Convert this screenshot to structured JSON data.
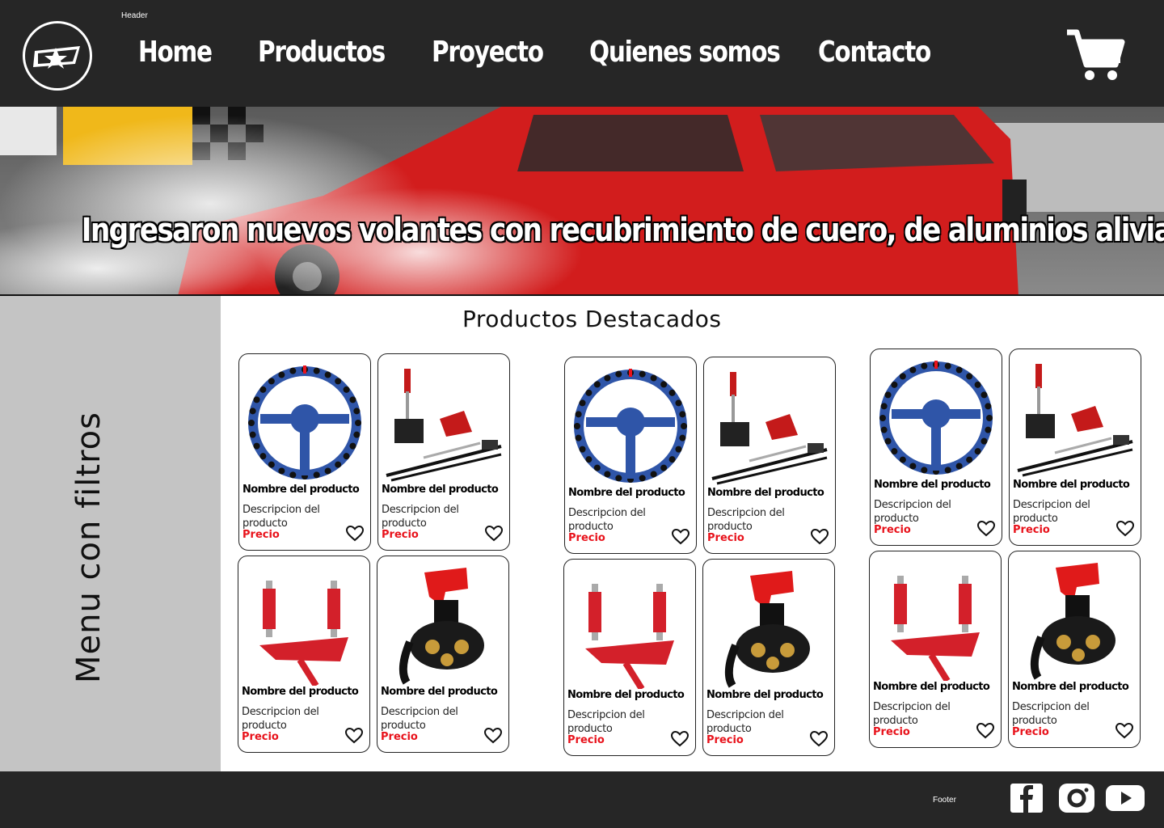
{
  "header": {
    "frame_label": "Header",
    "nav": [
      {
        "label": "Home"
      },
      {
        "label": "Productos"
      },
      {
        "label": "Proyecto"
      },
      {
        "label": "Quienes somos"
      },
      {
        "label": "Contacto"
      }
    ],
    "cart_icon": "shopping-cart-icon"
  },
  "banner": {
    "text": "Ingresaron nuevos volantes  con recubrimiento de  cuero, de aluminios alivianados"
  },
  "sidebar": {
    "label": "Menu con filtros"
  },
  "main": {
    "title": "Productos Destacados"
  },
  "product_template": {
    "name": "Nombre del producto",
    "description": "Descripcion del producto",
    "price": "Precio"
  },
  "footer": {
    "frame_label": "Footer",
    "social": [
      "facebook-icon",
      "instagram-icon",
      "youtube-icon"
    ]
  },
  "colors": {
    "header_bg": "#262626",
    "sidebar_bg": "#c4c4c4",
    "price": "#e8121b",
    "banner_car": "#d21d1d"
  }
}
